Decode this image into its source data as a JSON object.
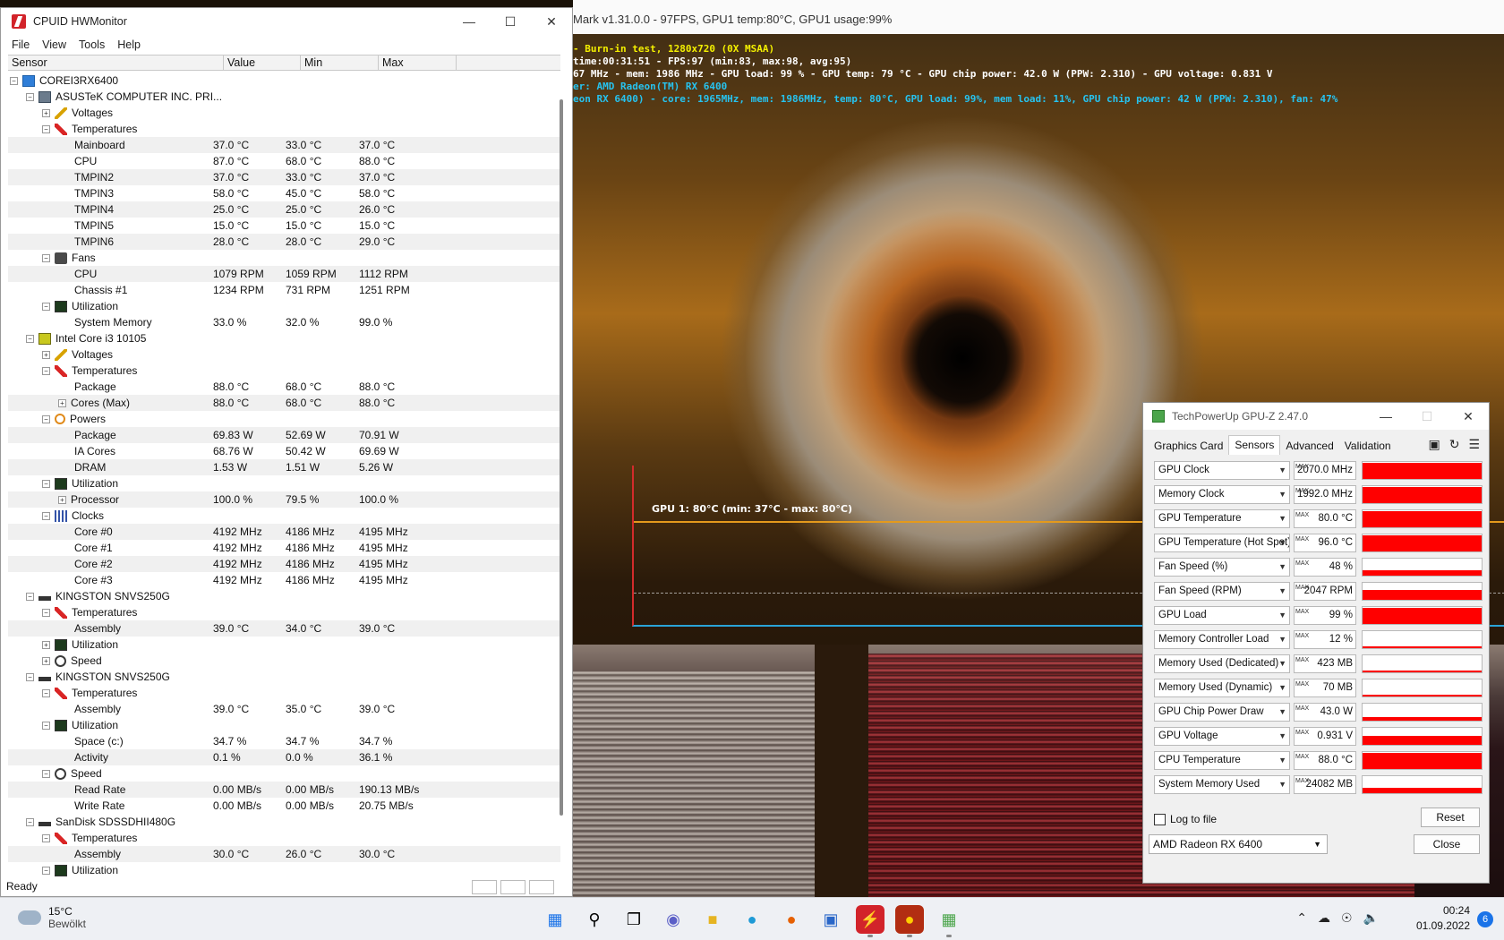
{
  "furmark": {
    "window_title": "Mark v1.31.0.0 - 97FPS, GPU1 temp:80°C, GPU1 usage:99%",
    "hud": [
      {
        "text": "- Burn-in test, 1280x720 (0X MSAA)",
        "color": "y"
      },
      {
        "text": "time:00:31:51 - FPS:97 (min:83, max:98, avg:95)",
        "color": "w"
      },
      {
        "text": "67 MHz - mem: 1986 MHz - GPU load: 99 % - GPU temp: 79 °C - GPU chip power: 42.0 W (PPW: 2.310) - GPU voltage: 0.831 V",
        "color": "w"
      },
      {
        "text": "er: AMD Radeon(TM) RX 6400",
        "color": "c"
      },
      {
        "text": "eon RX 6400) - core: 1965MHz, mem: 1986MHz, temp: 80°C, GPU load: 99%, mem load: 11%, GPU chip power: 42 W (PPW: 2.310), fan: 47%",
        "color": "c"
      }
    ],
    "graph_label": "GPU 1: 80°C (min: 37°C - max: 80°C)"
  },
  "hwmonitor": {
    "title": "CPUID HWMonitor",
    "menu": [
      "File",
      "View",
      "Tools",
      "Help"
    ],
    "columns": [
      "Sensor",
      "Value",
      "Min",
      "Max"
    ],
    "status": "Ready",
    "rows": [
      {
        "level": 0,
        "toggle": "-",
        "icon": "pc",
        "name": "COREI3RX6400",
        "value": "",
        "min": "",
        "max": ""
      },
      {
        "level": 1,
        "toggle": "-",
        "icon": "board",
        "name": "ASUSTeK COMPUTER INC. PRI...",
        "value": "",
        "min": "",
        "max": ""
      },
      {
        "level": 2,
        "toggle": "+",
        "icon": "volt",
        "name": "Voltages",
        "value": "",
        "min": "",
        "max": ""
      },
      {
        "level": 2,
        "toggle": "-",
        "icon": "temp",
        "name": "Temperatures",
        "value": "",
        "min": "",
        "max": ""
      },
      {
        "level": 3,
        "toggle": "",
        "icon": "",
        "name": "Mainboard",
        "value": "37.0 °C",
        "min": "33.0 °C",
        "max": "37.0 °C"
      },
      {
        "level": 3,
        "toggle": "",
        "icon": "",
        "name": "CPU",
        "value": "87.0 °C",
        "min": "68.0 °C",
        "max": "88.0 °C"
      },
      {
        "level": 3,
        "toggle": "",
        "icon": "",
        "name": "TMPIN2",
        "value": "37.0 °C",
        "min": "33.0 °C",
        "max": "37.0 °C"
      },
      {
        "level": 3,
        "toggle": "",
        "icon": "",
        "name": "TMPIN3",
        "value": "58.0 °C",
        "min": "45.0 °C",
        "max": "58.0 °C"
      },
      {
        "level": 3,
        "toggle": "",
        "icon": "",
        "name": "TMPIN4",
        "value": "25.0 °C",
        "min": "25.0 °C",
        "max": "26.0 °C"
      },
      {
        "level": 3,
        "toggle": "",
        "icon": "",
        "name": "TMPIN5",
        "value": "15.0 °C",
        "min": "15.0 °C",
        "max": "15.0 °C"
      },
      {
        "level": 3,
        "toggle": "",
        "icon": "",
        "name": "TMPIN6",
        "value": "28.0 °C",
        "min": "28.0 °C",
        "max": "29.0 °C"
      },
      {
        "level": 2,
        "toggle": "-",
        "icon": "fan",
        "name": "Fans",
        "value": "",
        "min": "",
        "max": ""
      },
      {
        "level": 3,
        "toggle": "",
        "icon": "",
        "name": "CPU",
        "value": "1079 RPM",
        "min": "1059 RPM",
        "max": "1112 RPM"
      },
      {
        "level": 3,
        "toggle": "",
        "icon": "",
        "name": "Chassis #1",
        "value": "1234 RPM",
        "min": "731 RPM",
        "max": "1251 RPM"
      },
      {
        "level": 2,
        "toggle": "-",
        "icon": "util",
        "name": "Utilization",
        "value": "",
        "min": "",
        "max": ""
      },
      {
        "level": 3,
        "toggle": "",
        "icon": "",
        "name": "System Memory",
        "value": "33.0 %",
        "min": "32.0 %",
        "max": "99.0 %"
      },
      {
        "level": 1,
        "toggle": "-",
        "icon": "cpu",
        "name": "Intel Core i3 10105",
        "value": "",
        "min": "",
        "max": ""
      },
      {
        "level": 2,
        "toggle": "+",
        "icon": "volt",
        "name": "Voltages",
        "value": "",
        "min": "",
        "max": ""
      },
      {
        "level": 2,
        "toggle": "-",
        "icon": "temp",
        "name": "Temperatures",
        "value": "",
        "min": "",
        "max": ""
      },
      {
        "level": 3,
        "toggle": "",
        "icon": "",
        "name": "Package",
        "value": "88.0 °C",
        "min": "68.0 °C",
        "max": "88.0 °C"
      },
      {
        "level": 3,
        "toggle": "+",
        "icon": "",
        "name": "Cores (Max)",
        "value": "88.0 °C",
        "min": "68.0 °C",
        "max": "88.0 °C"
      },
      {
        "level": 2,
        "toggle": "-",
        "icon": "power",
        "name": "Powers",
        "value": "",
        "min": "",
        "max": ""
      },
      {
        "level": 3,
        "toggle": "",
        "icon": "",
        "name": "Package",
        "value": "69.83 W",
        "min": "52.69 W",
        "max": "70.91 W"
      },
      {
        "level": 3,
        "toggle": "",
        "icon": "",
        "name": "IA Cores",
        "value": "68.76 W",
        "min": "50.42 W",
        "max": "69.69 W"
      },
      {
        "level": 3,
        "toggle": "",
        "icon": "",
        "name": "DRAM",
        "value": "1.53 W",
        "min": "1.51 W",
        "max": "5.26 W"
      },
      {
        "level": 2,
        "toggle": "-",
        "icon": "util",
        "name": "Utilization",
        "value": "",
        "min": "",
        "max": ""
      },
      {
        "level": 3,
        "toggle": "+",
        "icon": "",
        "name": "Processor",
        "value": "100.0 %",
        "min": "79.5 %",
        "max": "100.0 %"
      },
      {
        "level": 2,
        "toggle": "-",
        "icon": "clock",
        "name": "Clocks",
        "value": "",
        "min": "",
        "max": ""
      },
      {
        "level": 3,
        "toggle": "",
        "icon": "",
        "name": "Core #0",
        "value": "4192 MHz",
        "min": "4186 MHz",
        "max": "4195 MHz"
      },
      {
        "level": 3,
        "toggle": "",
        "icon": "",
        "name": "Core #1",
        "value": "4192 MHz",
        "min": "4186 MHz",
        "max": "4195 MHz"
      },
      {
        "level": 3,
        "toggle": "",
        "icon": "",
        "name": "Core #2",
        "value": "4192 MHz",
        "min": "4186 MHz",
        "max": "4195 MHz"
      },
      {
        "level": 3,
        "toggle": "",
        "icon": "",
        "name": "Core #3",
        "value": "4192 MHz",
        "min": "4186 MHz",
        "max": "4195 MHz"
      },
      {
        "level": 1,
        "toggle": "-",
        "icon": "disk",
        "name": "KINGSTON SNVS250G",
        "value": "",
        "min": "",
        "max": ""
      },
      {
        "level": 2,
        "toggle": "-",
        "icon": "temp",
        "name": "Temperatures",
        "value": "",
        "min": "",
        "max": ""
      },
      {
        "level": 3,
        "toggle": "",
        "icon": "",
        "name": "Assembly",
        "value": "39.0 °C",
        "min": "34.0 °C",
        "max": "39.0 °C"
      },
      {
        "level": 2,
        "toggle": "+",
        "icon": "util",
        "name": "Utilization",
        "value": "",
        "min": "",
        "max": ""
      },
      {
        "level": 2,
        "toggle": "+",
        "icon": "speed",
        "name": "Speed",
        "value": "",
        "min": "",
        "max": ""
      },
      {
        "level": 1,
        "toggle": "-",
        "icon": "disk",
        "name": "KINGSTON SNVS250G",
        "value": "",
        "min": "",
        "max": ""
      },
      {
        "level": 2,
        "toggle": "-",
        "icon": "temp",
        "name": "Temperatures",
        "value": "",
        "min": "",
        "max": ""
      },
      {
        "level": 3,
        "toggle": "",
        "icon": "",
        "name": "Assembly",
        "value": "39.0 °C",
        "min": "35.0 °C",
        "max": "39.0 °C"
      },
      {
        "level": 2,
        "toggle": "-",
        "icon": "util",
        "name": "Utilization",
        "value": "",
        "min": "",
        "max": ""
      },
      {
        "level": 3,
        "toggle": "",
        "icon": "",
        "name": "Space (c:)",
        "value": "34.7 %",
        "min": "34.7 %",
        "max": "34.7 %"
      },
      {
        "level": 3,
        "toggle": "",
        "icon": "",
        "name": "Activity",
        "value": "0.1 %",
        "min": "0.0 %",
        "max": "36.1 %"
      },
      {
        "level": 2,
        "toggle": "-",
        "icon": "speed",
        "name": "Speed",
        "value": "",
        "min": "",
        "max": ""
      },
      {
        "level": 3,
        "toggle": "",
        "icon": "",
        "name": "Read Rate",
        "value": "0.00 MB/s",
        "min": "0.00 MB/s",
        "max": "190.13 MB/s"
      },
      {
        "level": 3,
        "toggle": "",
        "icon": "",
        "name": "Write Rate",
        "value": "0.00 MB/s",
        "min": "0.00 MB/s",
        "max": "20.75 MB/s"
      },
      {
        "level": 1,
        "toggle": "-",
        "icon": "disk",
        "name": "SanDisk SDSSDHII480G",
        "value": "",
        "min": "",
        "max": ""
      },
      {
        "level": 2,
        "toggle": "-",
        "icon": "temp",
        "name": "Temperatures",
        "value": "",
        "min": "",
        "max": ""
      },
      {
        "level": 3,
        "toggle": "",
        "icon": "",
        "name": "Assembly",
        "value": "30.0 °C",
        "min": "26.0 °C",
        "max": "30.0 °C"
      },
      {
        "level": 2,
        "toggle": "-",
        "icon": "util",
        "name": "Utilization",
        "value": "",
        "min": "",
        "max": ""
      }
    ]
  },
  "gpuz": {
    "title": "TechPowerUp GPU-Z 2.47.0",
    "tabs": [
      "Graphics Card",
      "Sensors",
      "Advanced",
      "Validation"
    ],
    "active_tab": 1,
    "max_tag": "MAX",
    "sensors": [
      {
        "label": "GPU Clock",
        "value": "2070.0 MHz",
        "level": 0.97
      },
      {
        "label": "Memory Clock",
        "value": "1992.0 MHz",
        "level": 0.97
      },
      {
        "label": "GPU Temperature",
        "value": "80.0 °C",
        "level": 0.97
      },
      {
        "label": "GPU Temperature (Hot Spot)",
        "value": "96.0 °C",
        "level": 0.97
      },
      {
        "label": "Fan Speed (%)",
        "value": "48 %",
        "level": 0.3
      },
      {
        "label": "Fan Speed (RPM)",
        "value": "2047 RPM",
        "level": 0.6
      },
      {
        "label": "GPU Load",
        "value": "99 %",
        "level": 0.97
      },
      {
        "label": "Memory Controller Load",
        "value": "12 %",
        "level": 0.0
      },
      {
        "label": "Memory Used (Dedicated)",
        "value": "423 MB",
        "level": 0.08
      },
      {
        "label": "Memory Used (Dynamic)",
        "value": "70 MB",
        "level": 0.0
      },
      {
        "label": "GPU Chip Power Draw",
        "value": "43.0 W",
        "level": 0.2
      },
      {
        "label": "GPU Voltage",
        "value": "0.931 V",
        "level": 0.5
      },
      {
        "label": "CPU Temperature",
        "value": "88.0 °C",
        "level": 0.97
      },
      {
        "label": "System Memory Used",
        "value": "24082 MB",
        "level": 0.3
      }
    ],
    "log_label": "Log to file",
    "reset_label": "Reset",
    "device": "AMD Radeon RX 6400",
    "close_label": "Close",
    "accent": "#ff0000"
  },
  "taskbar": {
    "temp": "15°C",
    "condition": "Bewölkt",
    "time": "00:24",
    "date": "01.09.2022",
    "notifications": "6"
  }
}
